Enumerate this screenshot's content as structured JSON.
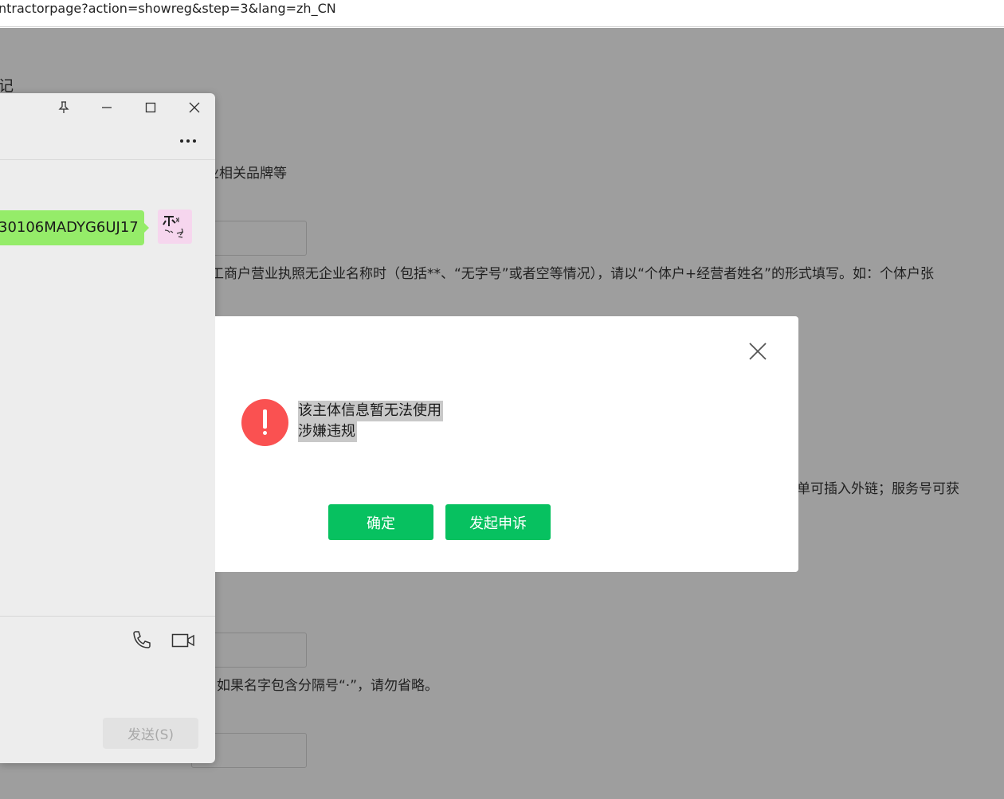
{
  "browser": {
    "url": "ntractorpage?action=showreg&step=3&lang=zh_CN"
  },
  "page": {
    "heading_fragment": "记",
    "hint_brand": "业相关品牌等",
    "hint_business": "工商户营业执照无企业名称时（包括**、“无字号”或者空等情况），请以“个体户+经营者姓名”的形式填写。如：个体户张",
    "hint_links": "单可插入外链；服务号可获",
    "hint_name": "如果名字包含分隔号“·”，请勿省略。"
  },
  "chat": {
    "message_text": "30106MADYG6UJ17",
    "send_label": "发送(S)"
  },
  "dialog": {
    "message_line1": "该主体信息暂无法使用",
    "message_line2": "涉嫌违规",
    "confirm_label": "确定",
    "appeal_label": "发起申诉"
  },
  "colors": {
    "primary_green": "#07c160",
    "warning_red": "#fa5151",
    "chat_bubble": "#95ec69"
  }
}
